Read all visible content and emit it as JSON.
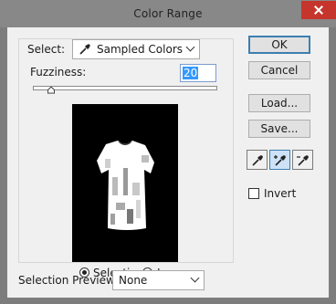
{
  "window": {
    "title": "Color Range",
    "close_icon": "close-icon"
  },
  "select": {
    "label": "Select:",
    "value": "Sampled Colors",
    "icon": "eyedropper-icon"
  },
  "fuzziness": {
    "label": "Fuzziness:",
    "value": "20",
    "slider_fraction": 0.1
  },
  "preview": {
    "mode_options": [
      "Selection",
      "Image"
    ],
    "selected_mode": "Selection"
  },
  "selection_preview": {
    "label": "Selection Preview:",
    "value": "None"
  },
  "buttons": {
    "ok": "OK",
    "cancel": "Cancel",
    "load": "Load...",
    "save": "Save..."
  },
  "tools": [
    {
      "name": "eyedropper-icon",
      "active": false
    },
    {
      "name": "eyedropper-plus-icon",
      "active": true
    },
    {
      "name": "eyedropper-minus-icon",
      "active": false
    }
  ],
  "invert": {
    "label": "Invert",
    "checked": false
  },
  "colors": {
    "titlebar": "#888888",
    "close": "#c6352b",
    "dialog": "#f0f0f0",
    "accent": "#3c7fb1"
  }
}
